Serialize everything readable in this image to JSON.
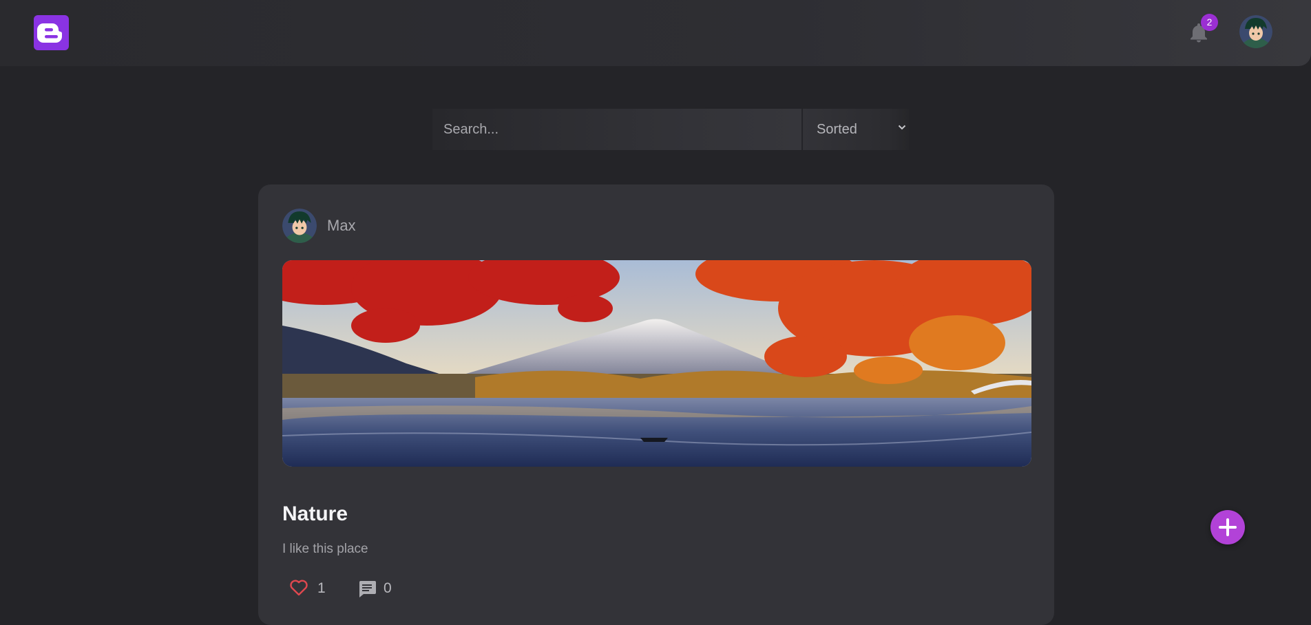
{
  "header": {
    "logo_icon": "blogger-logo-icon",
    "notifications": {
      "icon": "bell-icon",
      "count": "2"
    },
    "user_avatar": "user-avatar"
  },
  "search": {
    "placeholder": "Search...",
    "value": "",
    "sort_label": "Sorted",
    "sort_icon": "chevron-down-icon"
  },
  "post": {
    "author": "Max",
    "image": "mountain-lake-autumn-photo",
    "title": "Nature",
    "body": "I like this place",
    "likes": "1",
    "comments": "0",
    "like_icon": "heart-outline-icon",
    "comment_icon": "comment-icon"
  },
  "fab": {
    "icon": "plus-icon"
  },
  "colors": {
    "accent": "#8a33e3",
    "badge": "#9b2fd3",
    "fab": "#b242d8",
    "background": "#242428",
    "card": "#333338",
    "like": "#e0484f"
  }
}
